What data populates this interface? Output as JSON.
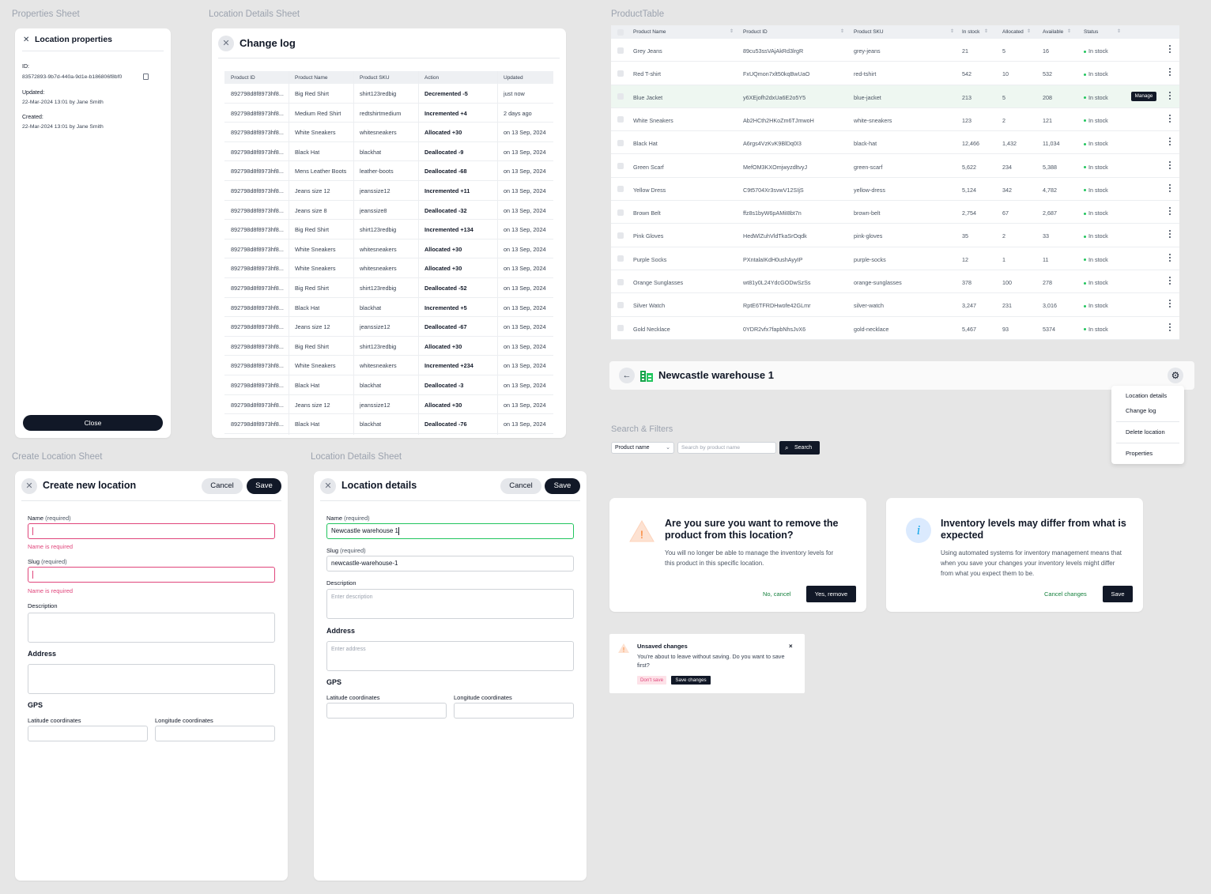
{
  "captions": {
    "properties_sheet": "Properties Sheet",
    "location_details_sheet_top": "Location Details Sheet",
    "product_table": "ProductTable",
    "create_location_sheet": "Create Location Sheet",
    "location_details_sheet_bottom": "Location Details Sheet",
    "search_filters": "Search & Filters"
  },
  "properties": {
    "title": "Location properties",
    "id_label": "ID:",
    "id_value": "83572893-9b7d-440a-9d1e-b186806f8bf0",
    "updated_label": "Updated:",
    "updated_value": "22-Mar-2024 13:01 by Jane Smith",
    "created_label": "Created:",
    "created_value": "22-Mar-2024 13:01 by Jane Smith",
    "close_label": "Close"
  },
  "changelog": {
    "title": "Change log",
    "headers": [
      "Product ID",
      "Product Name",
      "Product SKU",
      "Action",
      "Updated"
    ],
    "rows": [
      [
        "892798d8f8973hf8...",
        "Big Red Shirt",
        "shirt123redbig",
        "Decremented -5",
        "just now"
      ],
      [
        "892798d8f8973hf8...",
        "Medium Red Shirt",
        "redtshirtmedium",
        "Incremented +4",
        "2 days ago"
      ],
      [
        "892798d8f8973hf8...",
        "White Sneakers",
        "whitesneakers",
        "Allocated +30",
        "on 13 Sep, 2024"
      ],
      [
        "892798d8f8973hf8...",
        "Black Hat",
        "blackhat",
        "Deallocated -9",
        "on 13 Sep, 2024"
      ],
      [
        "892798d8f8973hf8...",
        "Mens Leather Boots",
        "leather-boots",
        "Deallocated -68",
        "on 13 Sep, 2024"
      ],
      [
        "892798d8f8973hf8...",
        "Jeans size 12",
        "jeanssize12",
        "Incremented +11",
        "on 13 Sep, 2024"
      ],
      [
        "892798d8f8973hf8...",
        "Jeans size 8",
        "jeanssize8",
        "Deallocated -32",
        "on 13 Sep, 2024"
      ],
      [
        "892798d8f8973hf8...",
        "Big Red Shirt",
        "shirt123redbig",
        "Incremented +134",
        "on 13 Sep, 2024"
      ],
      [
        "892798d8f8973hf8...",
        "White Sneakers",
        "whitesneakers",
        "Allocated +30",
        "on 13 Sep, 2024"
      ],
      [
        "892798d8f8973hf8...",
        "White Sneakers",
        "whitesneakers",
        "Allocated +30",
        "on 13 Sep, 2024"
      ],
      [
        "892798d8f8973hf8...",
        "Big Red Shirt",
        "shirt123redbig",
        "Deallocated -52",
        "on 13 Sep, 2024"
      ],
      [
        "892798d8f8973hf8...",
        "Black Hat",
        "blackhat",
        "Incremented +5",
        "on 13 Sep, 2024"
      ],
      [
        "892798d8f8973hf8...",
        "Jeans size 12",
        "jeanssize12",
        "Deallocated -67",
        "on 13 Sep, 2024"
      ],
      [
        "892798d8f8973hf8...",
        "Big Red Shirt",
        "shirt123redbig",
        "Allocated +30",
        "on 13 Sep, 2024"
      ],
      [
        "892798d8f8973hf8...",
        "White Sneakers",
        "whitesneakers",
        "Incremented +234",
        "on 13 Sep, 2024"
      ],
      [
        "892798d8f8973hf8...",
        "Black Hat",
        "blackhat",
        "Deallocated -3",
        "on 13 Sep, 2024"
      ],
      [
        "892798d8f8973hf8...",
        "Jeans size 12",
        "jeanssize12",
        "Allocated +30",
        "on 13 Sep, 2024"
      ],
      [
        "892798d8f8973hf8...",
        "Black Hat",
        "blackhat",
        "Deallocated -76",
        "on 13 Sep, 2024"
      ]
    ]
  },
  "product_table": {
    "headers": [
      "Product Name",
      "Product ID",
      "Product SKU",
      "In stock",
      "Allocated",
      "Available",
      "Status"
    ],
    "manage_label": "Manage",
    "rows": [
      [
        "Grey Jeans",
        "89cu53ssVAjAkRd3lrgR",
        "grey-jeans",
        "21",
        "5",
        "16",
        "In stock"
      ],
      [
        "Red T-shirt",
        "FxUQmon7xlt50kqBwUaO",
        "red-tshirt",
        "542",
        "10",
        "532",
        "In stock"
      ],
      [
        "Blue Jacket",
        "y6XEjofh2dxUa6E2o5Y5",
        "blue-jacket",
        "213",
        "5",
        "208",
        "In stock"
      ],
      [
        "White Sneakers",
        "Ab2HCth2HKoZm6TJmwoH",
        "white-sneakers",
        "123",
        "2",
        "121",
        "In stock"
      ],
      [
        "Black Hat",
        "A6rgs4VzKvK9BlDq0I3",
        "black-hat",
        "12,466",
        "1,432",
        "11,034",
        "In stock"
      ],
      [
        "Green Scarf",
        "MefOM3KXOmjwyzdltvyJ",
        "green-scarf",
        "5,622",
        "234",
        "5,388",
        "In stock"
      ],
      [
        "Yellow Dress",
        "C9t5704Xr3svwV12SIjS",
        "yellow-dress",
        "5,124",
        "342",
        "4,782",
        "In stock"
      ],
      [
        "Brown Belt",
        "ffz8s1byW6pAMiI8bt7n",
        "brown-belt",
        "2,754",
        "67",
        "2,687",
        "In stock"
      ],
      [
        "Pink Gloves",
        "HedWlZuhVldTkaSrOqdk",
        "pink-gloves",
        "35",
        "2",
        "33",
        "In stock"
      ],
      [
        "Purple Socks",
        "PXntalaIKdH0ushAyyIP",
        "purple-socks",
        "12",
        "1",
        "11",
        "In stock"
      ],
      [
        "Orange Sunglasses",
        "wt81y0L24YdcGODwSzSs",
        "orange-sunglasses",
        "378",
        "100",
        "278",
        "In stock"
      ],
      [
        "Silver Watch",
        "RptE6TFRDHwofe42GLmr",
        "silver-watch",
        "3,247",
        "231",
        "3,016",
        "In stock"
      ],
      [
        "Gold Necklace",
        "0YDR2vfx7fapbNhsJvX6",
        "gold-necklace",
        "5,467",
        "93",
        "5374",
        "In stock"
      ]
    ]
  },
  "location_header": {
    "title": "Newcastle warehouse 1",
    "menu": [
      "Location details",
      "Change log",
      "Delete location",
      "Properties"
    ]
  },
  "search": {
    "select_value": "Product name",
    "placeholder": "Search by product name",
    "button_label": "Search"
  },
  "create_location": {
    "title": "Create new location",
    "cancel_label": "Cancel",
    "save_label": "Save",
    "name_label": "Name",
    "required_note": "(required)",
    "name_error": "Name is required",
    "slug_label": "Slug",
    "slug_error": "Name is required",
    "description_label": "Description",
    "address_heading": "Address",
    "gps_heading": "GPS",
    "latitude_label": "Latitude coordinates",
    "longitude_label": "Longitude coordinates"
  },
  "location_details": {
    "title": "Location details",
    "cancel_label": "Cancel",
    "save_label": "Save",
    "name_label": "Name",
    "required_note": "(required)",
    "name_value": "Newcastle warehouse 1",
    "slug_label": "Slug",
    "slug_value": "newcastle-warehouse-1",
    "description_label": "Description",
    "description_placeholder": "Enter description",
    "address_heading": "Address",
    "address_placeholder": "Enter address",
    "gps_heading": "GPS",
    "latitude_label": "Latitude coordinates",
    "longitude_label": "Longitude coordinates"
  },
  "remove_dialog": {
    "title": "Are you sure you want to remove the product from this location?",
    "body": "You will no longer be able to manage the inventory levels for this product in this specific location.",
    "cancel_label": "No, cancel",
    "confirm_label": "Yes, remove"
  },
  "inventory_dialog": {
    "title": "Inventory levels may differ from what is expected",
    "body": "Using automated systems for inventory management means that when you save your changes your inventory levels might differ from what you expect them to be.",
    "cancel_label": "Cancel changes",
    "save_label": "Save"
  },
  "unsaved_toast": {
    "title": "Unsaved changes",
    "body": "You're about to leave without saving. Do you want to save first?",
    "dont_save_label": "Don't save",
    "save_label": "Save changes"
  },
  "colors": {
    "primary": "#111827",
    "danger": "#e0457b",
    "success": "#22c55e",
    "info": "#0ea5e9",
    "warning": "#f97316"
  },
  "icons": [
    "close-icon",
    "copy-icon",
    "sort-icon",
    "kebab-icon",
    "back-arrow-icon",
    "warehouse-icon",
    "gear-icon",
    "search-icon",
    "chevron-down-icon",
    "warning-icon",
    "info-icon"
  ]
}
